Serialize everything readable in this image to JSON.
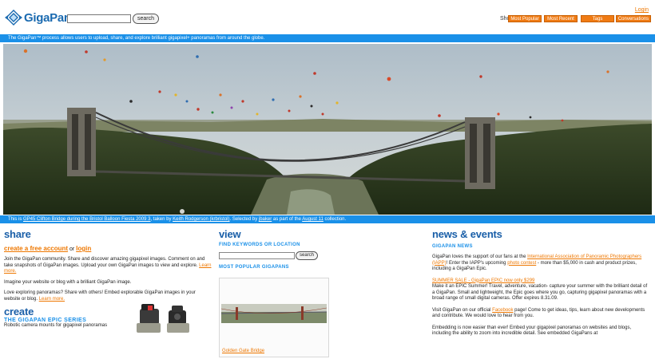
{
  "header": {
    "logo_text": "GigaPan",
    "search_button": "search",
    "login": "Login",
    "show_me": "Show me:",
    "filters": [
      "Most Popular",
      "Most Recent",
      "Tags",
      "Conversations"
    ]
  },
  "tagline": "The GigaPan™ process allows users to upload, share, and explore brilliant gigapixel+ panoramas from around the globe.",
  "caption": {
    "prefix": "This is ",
    "title_link": "GP45 Clifton Bridge during the Bristol Balloon Fiesta 2009 3",
    "taken_by": ", taken by ",
    "author_link": "Keith Rodgerson (krbristol)",
    "selected_by": ". Selected by ",
    "selector_link": "jbaker",
    "part_of": " as part of the ",
    "collection_link": "August 11",
    "suffix": " collection."
  },
  "share": {
    "title": "share",
    "create_account": "create a free account",
    "or": " or ",
    "login": "login",
    "p1": "Join the GigaPan community. Share and discover amazing gigapixel images. Comment on and take snapshots of GigaPan images. Upload your own GigaPan images to view and explore. ",
    "p1_link": "Learn more.",
    "p2": "Imagine your website or blog with a brilliant GigaPan image.",
    "p3": "Love exploring panoramas? Share with others! Embed explorable GigaPan images in your website or blog. ",
    "p3_link": "Learn more."
  },
  "create": {
    "title": "create",
    "epic_title": "THE GIGAPAN EPIC SERIES",
    "epic_desc": "Robotic camera mounts for gigapixel panoramas"
  },
  "view": {
    "title": "view",
    "find_title": "FIND KEYWORDS OR LOCATION",
    "search_button": "search",
    "popular_title": "MOST POPULAR GIGAPANS",
    "gigapan_link": "Golden Gate Bridge"
  },
  "news": {
    "title": "news & events",
    "subhead": "GIGAPAN NEWS",
    "n1_a": "GigaPan loves the support of our fans at the ",
    "n1_link1": "International Association of Panoramic Photographers (IAPP)",
    "n1_b": "! Enter the IAPP's upcoming ",
    "n1_link2": "photo contest",
    "n1_c": " - more than $5,000 in cash and product prizes, including a GigaPan Epic.",
    "n2_link": "SUMMER SALE - GigaPan EPIC now only $299",
    "n2_text": "Make it an EPIC Summer! Travel, adventure, vacation- capture your summer with the brilliant detail of a GigaPan. Small and lightweight, the Epic goes where you go, capturing gigapixel panoramas with a broad range of small digital cameras. Offer expires 8.31.09.",
    "n3_a": "Visit GigaPan on our official ",
    "n3_link": "Facebook",
    "n3_b": " page! Come to get ideas, tips, learn about new developments and contribute. We would love to hear from you.",
    "n4": "Embedding is now easier than ever! Embed your gigapixel panoramas on websites and blogs, including the ability to zoom into incredible detail. See embedded GigaPans at"
  },
  "colors": {
    "accent_orange": "#f07b14",
    "bar_blue": "#1a90e8",
    "heading_blue": "#1a5fa8"
  }
}
